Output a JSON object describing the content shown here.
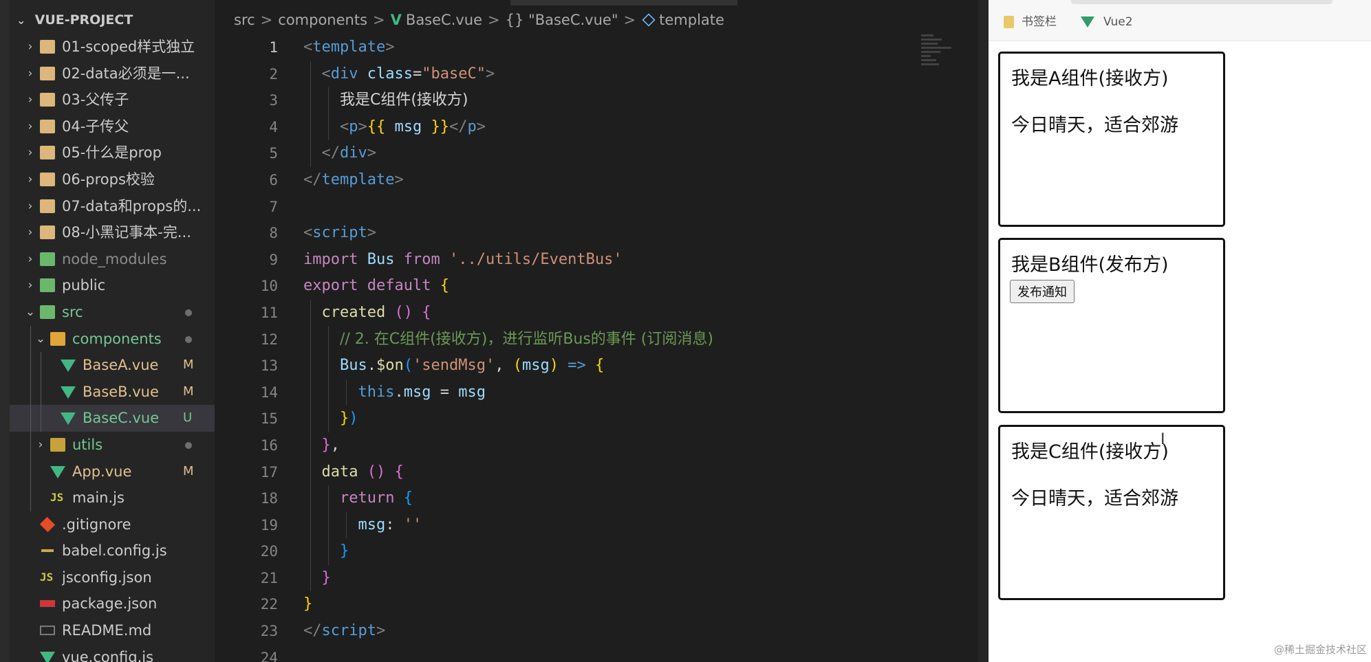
{
  "explorer": {
    "project_name": "VUE-PROJECT",
    "items": [
      {
        "label": "01-scoped样式独立",
        "kind": "folder",
        "depth": 0,
        "expanded": false
      },
      {
        "label": "02-data必须是一...",
        "kind": "folder",
        "depth": 0,
        "expanded": false
      },
      {
        "label": "03-父传子",
        "kind": "folder",
        "depth": 0,
        "expanded": false
      },
      {
        "label": "04-子传父",
        "kind": "folder",
        "depth": 0,
        "expanded": false
      },
      {
        "label": "05-什么是prop",
        "kind": "folder",
        "depth": 0,
        "expanded": false
      },
      {
        "label": "06-props校验",
        "kind": "folder",
        "depth": 0,
        "expanded": false
      },
      {
        "label": "07-data和props的...",
        "kind": "folder",
        "depth": 0,
        "expanded": false
      },
      {
        "label": "08-小黑记事本-完...",
        "kind": "folder",
        "depth": 0,
        "expanded": false
      },
      {
        "label": "node_modules",
        "kind": "folder",
        "depth": 0,
        "expanded": false
      },
      {
        "label": "public",
        "kind": "folder",
        "depth": 0,
        "expanded": false
      },
      {
        "label": "src",
        "kind": "folder",
        "depth": 0,
        "expanded": true
      },
      {
        "label": "components",
        "kind": "folder",
        "depth": 1,
        "expanded": true
      },
      {
        "label": "BaseA.vue",
        "kind": "vue",
        "depth": 2,
        "status": "M"
      },
      {
        "label": "BaseB.vue",
        "kind": "vue",
        "depth": 2,
        "status": "M"
      },
      {
        "label": "BaseC.vue",
        "kind": "vue",
        "depth": 2,
        "status": "U",
        "selected": true
      },
      {
        "label": "utils",
        "kind": "folder",
        "depth": 1,
        "expanded": false
      },
      {
        "label": "App.vue",
        "kind": "vue",
        "depth": 1,
        "status": "M"
      },
      {
        "label": "main.js",
        "kind": "js",
        "depth": 1
      },
      {
        "label": ".gitignore",
        "kind": "git",
        "depth": 0
      },
      {
        "label": "babel.config.js",
        "kind": "babel",
        "depth": 0
      },
      {
        "label": "jsconfig.json",
        "kind": "js",
        "depth": 0
      },
      {
        "label": "package.json",
        "kind": "npm",
        "depth": 0
      },
      {
        "label": "README.md",
        "kind": "md",
        "depth": 0
      },
      {
        "label": "vue.config.js",
        "kind": "vue",
        "depth": 0
      }
    ]
  },
  "breadcrumb": {
    "seg1": "src",
    "seg2": "components",
    "seg3": "BaseC.vue",
    "seg4": "{} \"BaseC.vue\"",
    "seg5": "template"
  },
  "editor": {
    "active_line": 1,
    "line_numbers": [
      "1",
      "2",
      "3",
      "4",
      "5",
      "6",
      "7",
      "8",
      "9",
      "10",
      "11",
      "12",
      "13",
      "14",
      "15",
      "16",
      "17",
      "18",
      "19",
      "20",
      "21",
      "22",
      "23",
      "24"
    ],
    "code": {
      "l1_open": "<",
      "l1_tag": "template",
      "l1_close": ">",
      "l2_tag": "div",
      "l2_attr": "class",
      "l2_val": "\"baseC\"",
      "l3_text": "我是C组件(接收方)",
      "l4_tag": "p",
      "l4_expr_open": "{{ ",
      "l4_var": "msg",
      "l4_expr_close": " }}",
      "l5_tag": "div",
      "l6_tag": "template",
      "l8_tag": "script",
      "l9_import": "import",
      "l9_bus": "Bus",
      "l9_from": "from",
      "l9_path": "'../utils/EventBus'",
      "l10_export": "export",
      "l10_default": "default",
      "l11_fn": "created",
      "l12_comment": "// 2. 在C组件(接收方)，进行监听Bus的事件 (订阅消息)",
      "l13_obj": "Bus",
      "l13_method": "$on",
      "l13_event": "'sendMsg'",
      "l13_param": "msg",
      "l14_this": "this",
      "l14_prop": "msg",
      "l14_val": "msg",
      "l17_fn": "data",
      "l18_return": "return",
      "l19_key": "msg",
      "l19_val": "''",
      "l23_tag": "script"
    }
  },
  "browser": {
    "bookmarks": [
      {
        "label": "书签栏",
        "icon": "folder-icon"
      },
      {
        "label": "Vue2",
        "icon": "vue-logo-icon"
      }
    ],
    "components": [
      {
        "title": "我是A组件(接收方)",
        "message": "今日晴天，适合郊游"
      },
      {
        "title": "我是B组件(发布方)",
        "button_label": "发布通知"
      },
      {
        "title": "我是C组件(接收方)",
        "message": "今日晴天，适合郊游"
      }
    ],
    "watermark": "@稀土掘金技术社区"
  },
  "colors": {
    "vue_green": "#41b883",
    "modified": "#e2c08d",
    "untracked": "#73c991",
    "editor_bg": "#1e1e1e",
    "sidebar_bg": "#252526"
  }
}
